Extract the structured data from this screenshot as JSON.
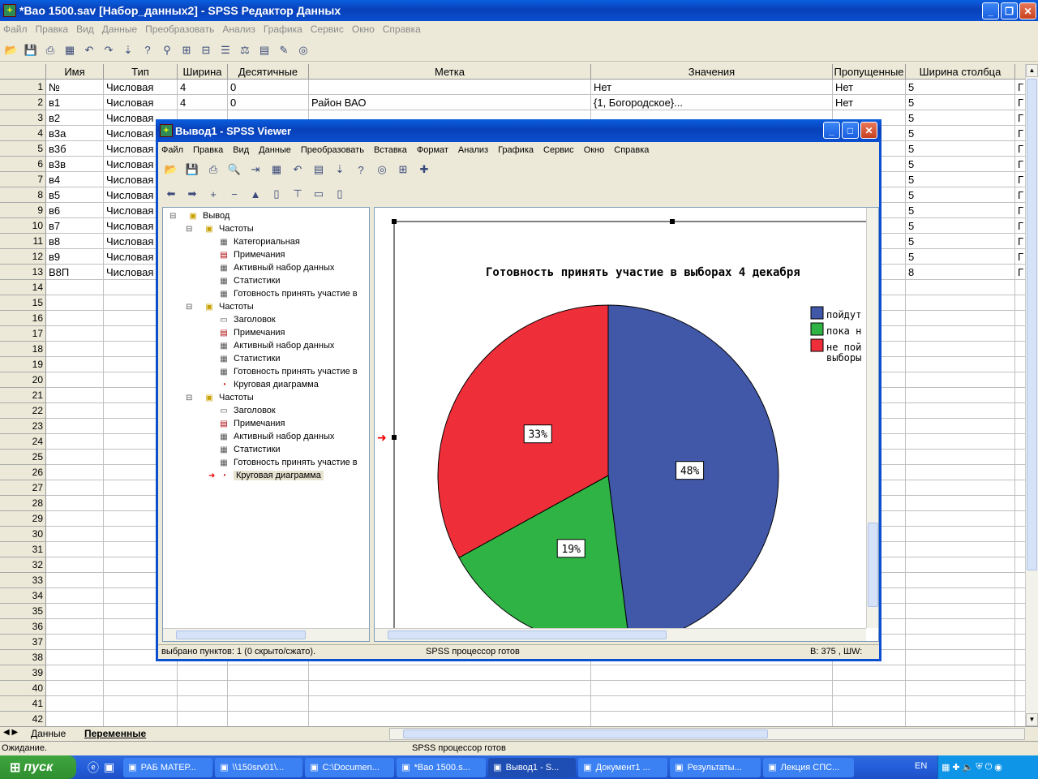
{
  "main": {
    "title": "*Вао 1500.sav [Набор_данных2] - SPSS Редактор Данных",
    "icon": "spss-data-icon",
    "menu": [
      "Файл",
      "Правка",
      "Вид",
      "Данные",
      "Преобразовать",
      "Анализ",
      "Графика",
      "Сервис",
      "Окно",
      "Справка"
    ],
    "columns": [
      "Имя",
      "Тип",
      "Ширина",
      "Десятичные",
      "Метка",
      "Значения",
      "Пропущенные",
      "Ширина столбца"
    ],
    "rows": [
      {
        "n": "1",
        "name": "№",
        "type": "Числовая",
        "width": "4",
        "dec": "0",
        "label": "",
        "values": "Нет",
        "missing": "Нет",
        "colwidth": "5"
      },
      {
        "n": "2",
        "name": "в1",
        "type": "Числовая",
        "width": "4",
        "dec": "0",
        "label": "Район ВАО",
        "values": "{1, Богородское}...",
        "missing": "Нет",
        "colwidth": "5"
      },
      {
        "n": "3",
        "name": "в2",
        "type": "Числовая",
        "width": "",
        "dec": "",
        "label": "",
        "values": "",
        "missing": "",
        "colwidth": "5"
      },
      {
        "n": "4",
        "name": "в3а",
        "type": "Числовая",
        "width": "",
        "dec": "",
        "label": "",
        "values": "",
        "missing": "",
        "colwidth": "5"
      },
      {
        "n": "5",
        "name": "в3б",
        "type": "Числовая",
        "width": "",
        "dec": "",
        "label": "",
        "values": "",
        "missing": "",
        "colwidth": "5"
      },
      {
        "n": "6",
        "name": "в3в",
        "type": "Числовая",
        "width": "",
        "dec": "",
        "label": "",
        "values": "",
        "missing": "",
        "colwidth": "5"
      },
      {
        "n": "7",
        "name": "в4",
        "type": "Числовая",
        "width": "",
        "dec": "",
        "label": "",
        "values": "",
        "missing": "",
        "colwidth": "5"
      },
      {
        "n": "8",
        "name": "в5",
        "type": "Числовая",
        "width": "",
        "dec": "",
        "label": "",
        "values": "",
        "missing": "",
        "colwidth": "5"
      },
      {
        "n": "9",
        "name": "в6",
        "type": "Числовая",
        "width": "",
        "dec": "",
        "label": "",
        "values": "",
        "missing": "",
        "colwidth": "5"
      },
      {
        "n": "10",
        "name": "в7",
        "type": "Числовая",
        "width": "",
        "dec": "",
        "label": "",
        "values": "",
        "missing": "",
        "colwidth": "5"
      },
      {
        "n": "11",
        "name": "в8",
        "type": "Числовая",
        "width": "",
        "dec": "",
        "label": "",
        "values": "",
        "missing": "",
        "colwidth": "5"
      },
      {
        "n": "12",
        "name": "в9",
        "type": "Числовая",
        "width": "",
        "dec": "",
        "label": "",
        "values": "",
        "missing": "",
        "colwidth": "5"
      },
      {
        "n": "13",
        "name": "В8П",
        "type": "Числовая",
        "width": "",
        "dec": "",
        "label": "",
        "values": "",
        "missing": "",
        "colwidth": "8"
      }
    ],
    "empty_rows": [
      "14",
      "15",
      "16",
      "17",
      "18",
      "19",
      "20",
      "21",
      "22",
      "23",
      "24",
      "25",
      "26",
      "27",
      "28",
      "29",
      "30",
      "31",
      "32",
      "33",
      "34",
      "35",
      "36",
      "37",
      "38",
      "39",
      "40",
      "41",
      "42"
    ],
    "extra_col_marker": "Г",
    "tabs": {
      "data": "Данные",
      "vars": "Переменные"
    },
    "status_left": "Ожидание.",
    "status_center": "SPSS процессор готов"
  },
  "viewer": {
    "title": "Вывод1 - SPSS Viewer",
    "menu": [
      "Файл",
      "Правка",
      "Вид",
      "Данные",
      "Преобразовать",
      "Вставка",
      "Формат",
      "Анализ",
      "Графика",
      "Сервис",
      "Окно",
      "Справка"
    ],
    "tree": [
      {
        "label": "Вывод",
        "level": 0,
        "icon": "output-book-icon"
      },
      {
        "label": "Частоты",
        "level": 1,
        "icon": "folder-book-icon"
      },
      {
        "label": "Категориальная",
        "level": 2,
        "icon": "table-icon"
      },
      {
        "label": "Примечания",
        "level": 2,
        "icon": "notes-icon"
      },
      {
        "label": "Активный набор данных",
        "level": 2,
        "icon": "table-icon"
      },
      {
        "label": "Статистики",
        "level": 2,
        "icon": "table-icon"
      },
      {
        "label": "Готовность принять участие в",
        "level": 2,
        "icon": "table-icon"
      },
      {
        "label": "Частоты",
        "level": 1,
        "icon": "folder-book-icon"
      },
      {
        "label": "Заголовок",
        "level": 2,
        "icon": "heading-icon"
      },
      {
        "label": "Примечания",
        "level": 2,
        "icon": "notes-icon"
      },
      {
        "label": "Активный набор данных",
        "level": 2,
        "icon": "table-icon"
      },
      {
        "label": "Статистики",
        "level": 2,
        "icon": "table-icon"
      },
      {
        "label": "Готовность принять участие в",
        "level": 2,
        "icon": "table-icon"
      },
      {
        "label": "Круговая диаграмма",
        "level": 2,
        "icon": "chart-icon"
      },
      {
        "label": "Частоты",
        "level": 1,
        "icon": "folder-book-icon"
      },
      {
        "label": "Заголовок",
        "level": 2,
        "icon": "heading-icon"
      },
      {
        "label": "Примечания",
        "level": 2,
        "icon": "notes-icon"
      },
      {
        "label": "Активный набор данных",
        "level": 2,
        "icon": "table-icon"
      },
      {
        "label": "Статистики",
        "level": 2,
        "icon": "table-icon"
      },
      {
        "label": "Готовность принять участие в",
        "level": 2,
        "icon": "table-icon"
      },
      {
        "label": "Круговая диаграмма",
        "level": 2,
        "icon": "chart-icon",
        "selected": true
      }
    ],
    "status_left": "выбрано пунктов: 1  (0 скрыто/сжато).",
    "status_center": "SPSS процессор готов",
    "status_right": "В: 375 , ШW:"
  },
  "chart_data": {
    "type": "pie",
    "title": "Готовность принять участие в выборах 4 декабря",
    "slices": [
      {
        "name": "пойдут",
        "value": 48,
        "label": "48%",
        "color": "#4158a8"
      },
      {
        "name": "пока н",
        "value": 19,
        "label": "19%",
        "color": "#2fb344"
      },
      {
        "name": "не пой выборы",
        "value": 33,
        "label": "33%",
        "color": "#ee2f3a"
      }
    ],
    "legend": [
      "пойдут",
      "пока н",
      "не пой",
      "выборы"
    ],
    "legend_position": "right"
  },
  "taskbar": {
    "start": "пуск",
    "tasks": [
      "РАБ МАТЕР...",
      "\\\\150srv01\\...",
      "C:\\Documen...",
      "*Вао 1500.s...",
      "Вывод1 - S...",
      "Документ1 ...",
      "Результаты...",
      "Лекция СПС..."
    ],
    "lang": "EN"
  }
}
